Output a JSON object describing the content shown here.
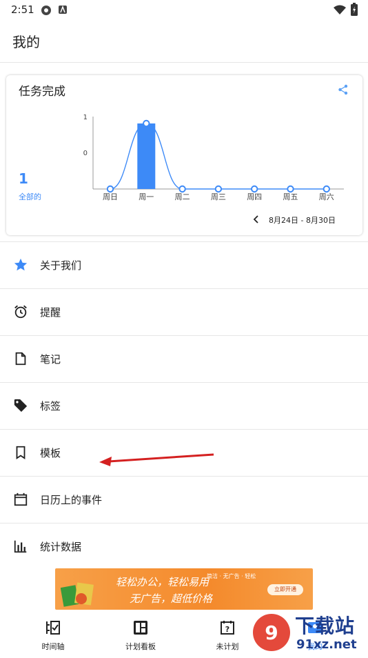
{
  "status": {
    "time": "2:51"
  },
  "header": {
    "title": "我的"
  },
  "card": {
    "title": "任务完成",
    "total": "1",
    "total_label": "全部的",
    "date_range": "8月24日 - 8月30日",
    "chart_data": {
      "type": "bar",
      "categories": [
        "周日",
        "周一",
        "周二",
        "周三",
        "周四",
        "周五",
        "周六"
      ],
      "values": [
        0,
        1,
        0,
        0,
        0,
        0,
        0
      ],
      "ytick_labels": [
        "1",
        "0"
      ],
      "bar_color": "#3d8af7"
    }
  },
  "menu": [
    {
      "label": "关于我们",
      "icon": "star-icon"
    },
    {
      "label": "提醒",
      "icon": "alarm-icon"
    },
    {
      "label": "笔记",
      "icon": "note-icon"
    },
    {
      "label": "标签",
      "icon": "tag-icon"
    },
    {
      "label": "模板",
      "icon": "bookmark-icon"
    },
    {
      "label": "日历上的事件",
      "icon": "calendar-icon"
    },
    {
      "label": "统计数据",
      "icon": "bar-chart-icon"
    }
  ],
  "ad": {
    "line1": "轻松办公，轻松易用",
    "line2": "无广告，超低价格",
    "tags": "简洁 · 无广告 · 轻松",
    "button": "立即开通"
  },
  "tabs": [
    {
      "label": "时间轴",
      "icon": "timeline-icon"
    },
    {
      "label": "计划看板",
      "icon": "board-icon"
    },
    {
      "label": "未计划",
      "icon": "unplanned-icon"
    },
    {
      "label": "我的",
      "icon": "profile-icon"
    }
  ],
  "watermark": {
    "brand": "下载站",
    "url": "91xz.net"
  },
  "colors": {
    "accent": "#3d8af7",
    "arrow": "#d42020"
  }
}
